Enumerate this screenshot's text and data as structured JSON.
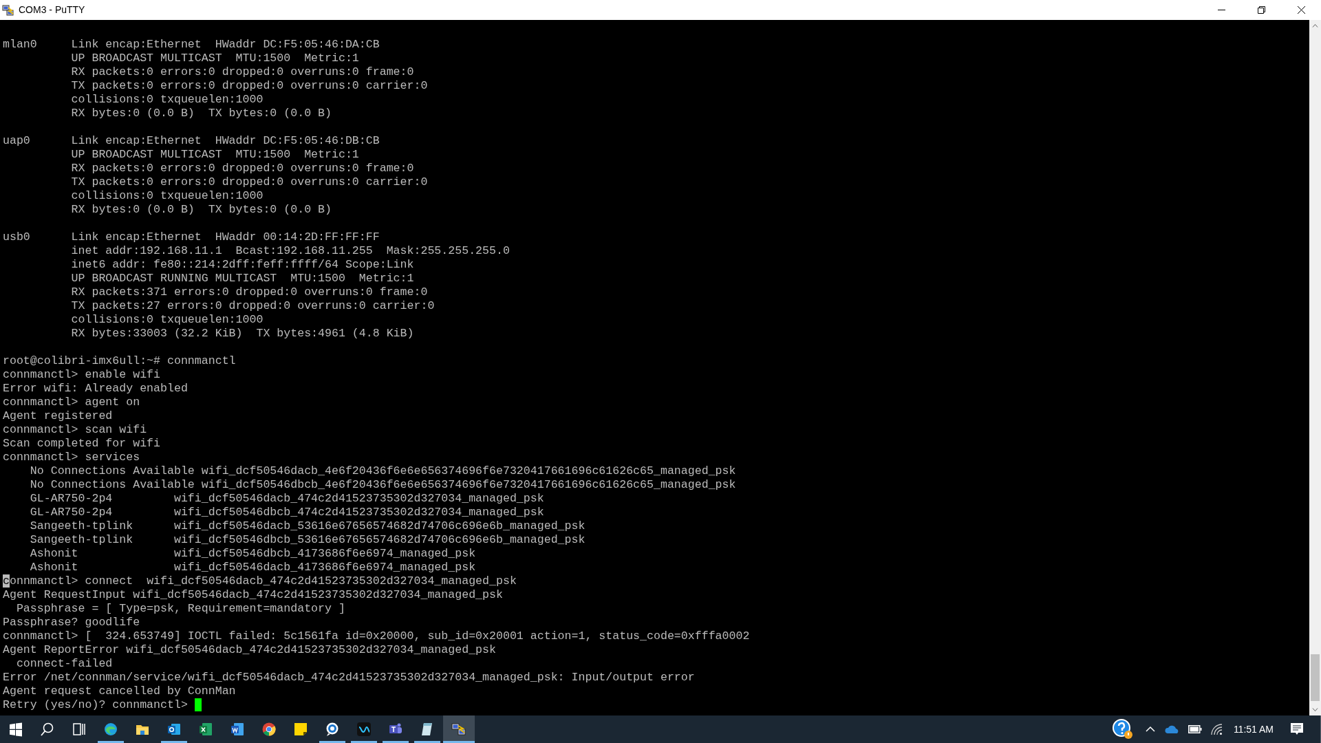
{
  "window": {
    "title": "COM3 - PuTTY"
  },
  "terminal": {
    "blocks": [
      [
        {
          "text": "mlan0     Link encap:Ethernet  HWaddr DC:F5:05:46:DA:CB"
        },
        {
          "text": "          UP BROADCAST MULTICAST  MTU:1500  Metric:1"
        },
        {
          "text": "          RX packets:0 errors:0 dropped:0 overruns:0 frame:0"
        },
        {
          "text": "          TX packets:0 errors:0 dropped:0 overruns:0 carrier:0"
        },
        {
          "text": "          collisions:0 txqueuelen:1000"
        },
        {
          "text": "          RX bytes:0 (0.0 B)  TX bytes:0 (0.0 B)"
        }
      ],
      [
        {
          "text": "uap0      Link encap:Ethernet  HWaddr DC:F5:05:46:DB:CB"
        },
        {
          "text": "          UP BROADCAST MULTICAST  MTU:1500  Metric:1"
        },
        {
          "text": "          RX packets:0 errors:0 dropped:0 overruns:0 frame:0"
        },
        {
          "text": "          TX packets:0 errors:0 dropped:0 overruns:0 carrier:0"
        },
        {
          "text": "          collisions:0 txqueuelen:1000"
        },
        {
          "text": "          RX bytes:0 (0.0 B)  TX bytes:0 (0.0 B)"
        }
      ],
      [
        {
          "text": "usb0      Link encap:Ethernet  HWaddr 00:14:2D:FF:FF:FF"
        },
        {
          "text": "          inet addr:192.168.11.1  Bcast:192.168.11.255  Mask:255.255.255.0"
        },
        {
          "text": "          inet6 addr: fe80::214:2dff:feff:ffff/64 Scope:Link"
        },
        {
          "text": "          UP BROADCAST RUNNING MULTICAST  MTU:1500  Metric:1"
        },
        {
          "text": "          RX packets:371 errors:0 dropped:0 overruns:0 frame:0"
        },
        {
          "text": "          TX packets:27 errors:0 dropped:0 overruns:0 carrier:0"
        },
        {
          "text": "          collisions:0 txqueuelen:1000"
        },
        {
          "text": "          RX bytes:33003 (32.2 KiB)  TX bytes:4961 (4.8 KiB)"
        }
      ],
      [
        {
          "text": "root@colibri-imx6ull:~# connmanctl"
        },
        {
          "text": "connmanctl> enable wifi"
        },
        {
          "text": "Error wifi: Already enabled"
        },
        {
          "text": "connmanctl> agent on"
        },
        {
          "text": "Agent registered"
        },
        {
          "text": "connmanctl> scan wifi"
        },
        {
          "text": "Scan completed for wifi"
        },
        {
          "text": "connmanctl> services"
        },
        {
          "text": "    No Connections Available wifi_dcf50546dacb_4e6f20436f6e6e656374696f6e7320417661696c61626c65_managed_psk"
        },
        {
          "text": "    No Connections Available wifi_dcf50546dbcb_4e6f20436f6e6e656374696f6e7320417661696c61626c65_managed_psk"
        },
        {
          "text": "    GL-AR750-2p4         wifi_dcf50546dacb_474c2d41523735302d327034_managed_psk"
        },
        {
          "text": "    GL-AR750-2p4         wifi_dcf50546dbcb_474c2d41523735302d327034_managed_psk"
        },
        {
          "text": "    Sangeeth-tplink      wifi_dcf50546dacb_53616e67656574682d74706c696e6b_managed_psk"
        },
        {
          "text": "    Sangeeth-tplink      wifi_dcf50546dbcb_53616e67656574682d74706c696e6b_managed_psk"
        },
        {
          "text": "    Ashonit              wifi_dcf50546dbcb_4173686f6e6974_managed_psk"
        },
        {
          "text": "    Ashonit              wifi_dcf50546dacb_4173686f6e6974_managed_psk"
        },
        {
          "text": "connmanctl> connect  wifi_dcf50546dacb_474c2d41523735302d327034_managed_psk",
          "marked_first": true
        },
        {
          "text": "Agent RequestInput wifi_dcf50546dacb_474c2d41523735302d327034_managed_psk"
        },
        {
          "text": "  Passphrase = [ Type=psk, Requirement=mandatory ]"
        },
        {
          "text": "Passphrase? goodlife"
        },
        {
          "text": "connmanctl> [  324.653749] IOCTL failed: 5c1561fa id=0x20000, sub_id=0x20001 action=1, status_code=0xfffa0002"
        },
        {
          "text": "Agent ReportError wifi_dcf50546dacb_474c2d41523735302d327034_managed_psk"
        },
        {
          "text": "  connect-failed"
        },
        {
          "text": "Error /net/connman/service/wifi_dcf50546dacb_474c2d41523735302d327034_managed_psk: Input/output error"
        },
        {
          "text": "Agent request cancelled by ConnMan"
        },
        {
          "text": "Retry (yes/no)? connmanctl> ",
          "cursor": true
        }
      ]
    ]
  },
  "taskbar": {
    "apps": [
      {
        "kind": "start",
        "running": false,
        "active": false
      },
      {
        "kind": "search",
        "running": false,
        "active": false
      },
      {
        "kind": "taskview",
        "running": false,
        "active": false
      },
      {
        "kind": "edge",
        "running": true,
        "active": false
      },
      {
        "kind": "folder",
        "running": false,
        "active": false
      },
      {
        "kind": "mail",
        "running": true,
        "active": false
      },
      {
        "kind": "sheet",
        "running": false,
        "active": false
      },
      {
        "kind": "doc",
        "running": false,
        "active": false
      },
      {
        "kind": "chrome",
        "running": false,
        "active": false
      },
      {
        "kind": "note",
        "running": false,
        "active": false
      },
      {
        "kind": "chat",
        "running": true,
        "active": false
      },
      {
        "kind": "meet",
        "running": true,
        "active": false
      },
      {
        "kind": "teams",
        "running": true,
        "active": false
      },
      {
        "kind": "pad",
        "running": true,
        "active": false
      },
      {
        "kind": "putty",
        "running": true,
        "active": true
      }
    ],
    "clock": "11:51 AM"
  }
}
